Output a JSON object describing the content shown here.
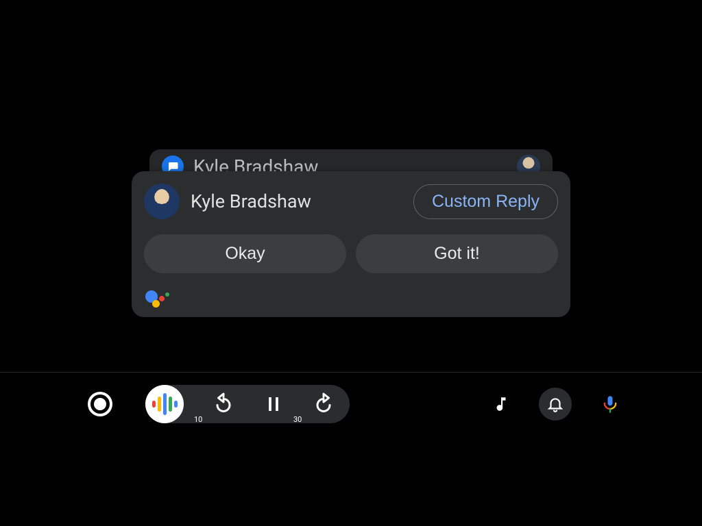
{
  "stacked_card": {
    "app_icon_name": "messages-app-icon",
    "sender_name": "Kyle Bradshaw"
  },
  "notification": {
    "sender_name": "Kyle Bradshaw",
    "custom_reply_label": "Custom Reply",
    "quick_replies": [
      "Okay",
      "Got it!"
    ],
    "assistant_icon_name": "google-assistant-icon"
  },
  "navbar": {
    "home_icon": "home-circle-icon",
    "active_app_icon": "google-podcasts-icon",
    "rewind_seconds": "10",
    "forward_seconds": "30",
    "music_icon": "music-note-icon",
    "bell_icon": "bell-icon",
    "mic_icon": "assistant-mic-icon"
  }
}
